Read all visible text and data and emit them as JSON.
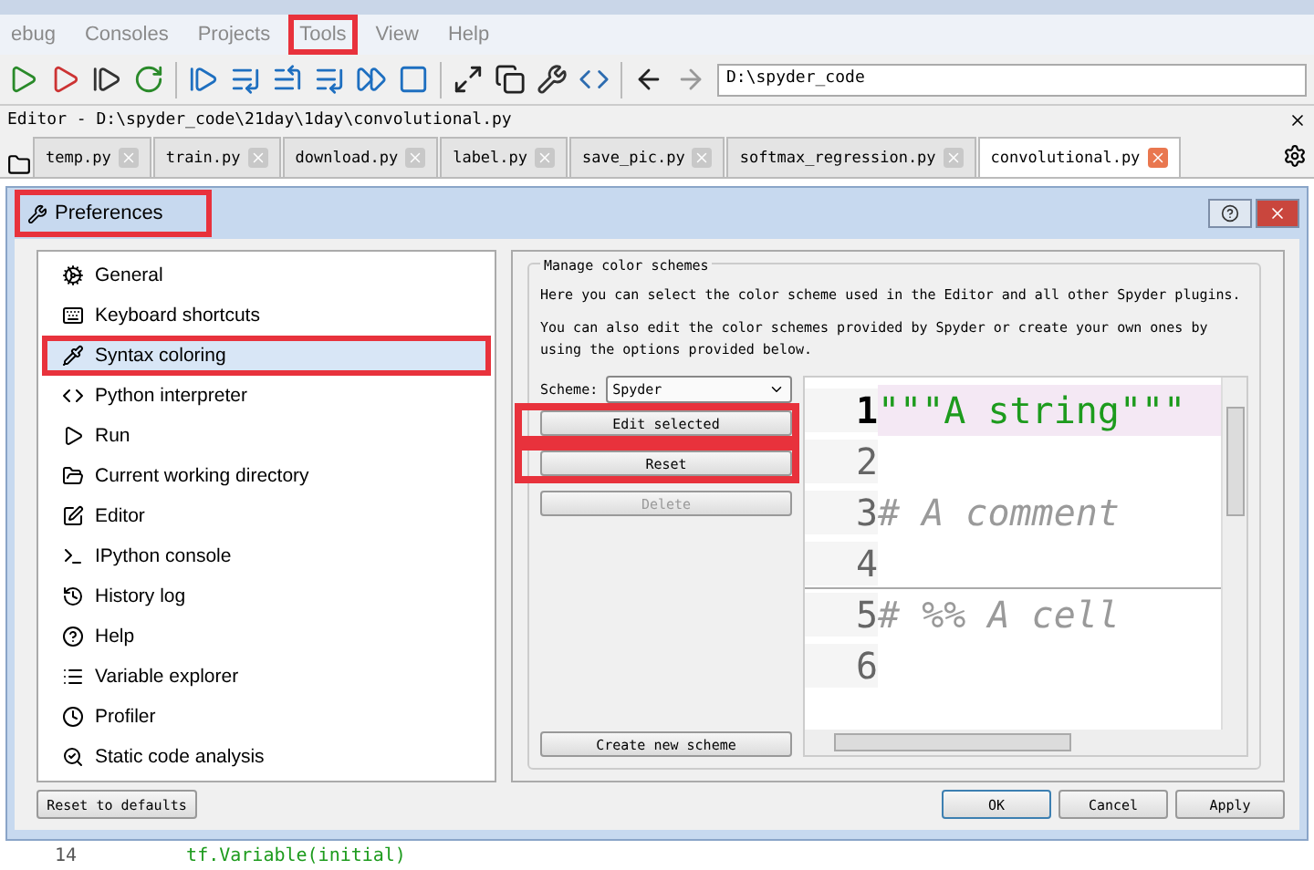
{
  "menu": [
    {
      "label": "ebug",
      "highlighted": false
    },
    {
      "label": "Consoles",
      "highlighted": false
    },
    {
      "label": "Projects",
      "highlighted": false
    },
    {
      "label": "Tools",
      "highlighted": true
    },
    {
      "label": "View",
      "highlighted": false
    },
    {
      "label": "Help",
      "highlighted": false
    }
  ],
  "toolbar": {
    "path": "D:\\spyder_code"
  },
  "editor": {
    "title": "Editor - D:\\spyder_code\\21day\\1day\\convolutional.py",
    "tabs": [
      {
        "label": "temp.py",
        "selected": false
      },
      {
        "label": "train.py",
        "selected": false
      },
      {
        "label": "download.py",
        "selected": false
      },
      {
        "label": "label.py",
        "selected": false
      },
      {
        "label": "save_pic.py",
        "selected": false
      },
      {
        "label": "softmax_regression.py",
        "selected": false
      },
      {
        "label": "convolutional.py",
        "selected": true
      }
    ]
  },
  "dialog": {
    "title": "Preferences",
    "highlighted": true,
    "sections": [
      {
        "label": "General",
        "selected": false,
        "highlighted": false
      },
      {
        "label": "Keyboard shortcuts",
        "selected": false,
        "highlighted": false
      },
      {
        "label": "Syntax coloring",
        "selected": true,
        "highlighted": true
      },
      {
        "label": "Python interpreter",
        "selected": false,
        "highlighted": false
      },
      {
        "label": "Run",
        "selected": false,
        "highlighted": false
      },
      {
        "label": "Current working directory",
        "selected": false,
        "highlighted": false
      },
      {
        "label": "Editor",
        "selected": false,
        "highlighted": false
      },
      {
        "label": "IPython console",
        "selected": false,
        "highlighted": false
      },
      {
        "label": "History log",
        "selected": false,
        "highlighted": false
      },
      {
        "label": "Help",
        "selected": false,
        "highlighted": false
      },
      {
        "label": "Variable explorer",
        "selected": false,
        "highlighted": false
      },
      {
        "label": "Profiler",
        "selected": false,
        "highlighted": false
      },
      {
        "label": "Static code analysis",
        "selected": false,
        "highlighted": false
      }
    ],
    "reset_button": "Reset to defaults",
    "group_title": "Manage color schemes",
    "description": [
      "Here you can select the color scheme used in the Editor and all other Spyder plugins.",
      "You can also edit the color schemes provided by Spyder or create your own ones by using the options provided below."
    ],
    "scheme_label": "Scheme:",
    "scheme_value": "Spyder",
    "scheme_buttons": [
      {
        "label": "Edit selected",
        "disabled": false,
        "highlighted": true
      },
      {
        "label": "Reset",
        "disabled": false,
        "highlighted": true
      },
      {
        "label": "Delete",
        "disabled": true,
        "highlighted": false
      }
    ],
    "create_button": "Create new scheme",
    "preview": [
      {
        "number": "1",
        "text": "\"\"\"A string\"\"\"",
        "kind": "string"
      },
      {
        "number": "2",
        "kind": "blank"
      },
      {
        "number": "3",
        "text": "# A comment",
        "kind": "comment"
      },
      {
        "number": "4",
        "kind": "blank"
      },
      {
        "number": "5",
        "text": "# %% A cell",
        "kind": "cell"
      },
      {
        "number": "6",
        "kind": "blank"
      }
    ],
    "buttons": [
      "OK",
      "Cancel",
      "Apply"
    ]
  },
  "background_code": {
    "line_number": "14",
    "text": "tf.Variable(initial)"
  }
}
